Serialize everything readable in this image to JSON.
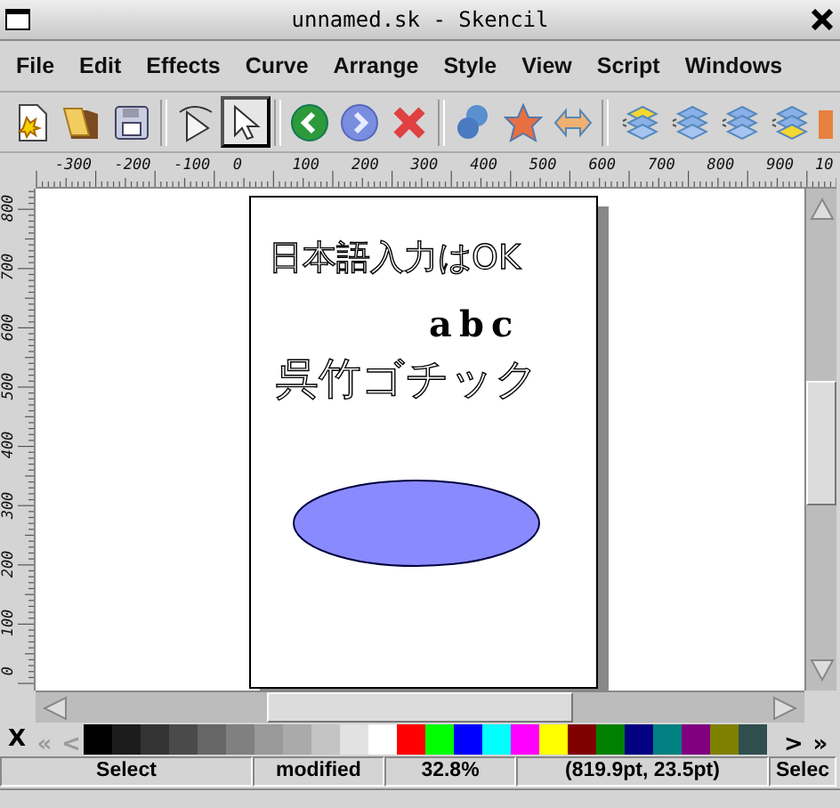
{
  "window": {
    "title": "unnamed.sk - Skencil"
  },
  "menu": [
    "File",
    "Edit",
    "Effects",
    "Curve",
    "Arrange",
    "Style",
    "View",
    "Script",
    "Windows"
  ],
  "toolbar": [
    {
      "kind": "new",
      "selected": false
    },
    {
      "kind": "open",
      "selected": false
    },
    {
      "kind": "save",
      "selected": false
    },
    {
      "kind": "sep"
    },
    {
      "kind": "edit",
      "selected": false
    },
    {
      "kind": "select",
      "selected": true
    },
    {
      "kind": "sep"
    },
    {
      "kind": "undo",
      "selected": false
    },
    {
      "kind": "redo",
      "selected": false
    },
    {
      "kind": "delete",
      "selected": false
    },
    {
      "kind": "sep"
    },
    {
      "kind": "group",
      "selected": false
    },
    {
      "kind": "star",
      "selected": false
    },
    {
      "kind": "arrows",
      "selected": false
    },
    {
      "kind": "sep"
    },
    {
      "kind": "raise",
      "selected": false
    },
    {
      "kind": "lower",
      "selected": false
    },
    {
      "kind": "layer",
      "selected": false
    },
    {
      "kind": "back",
      "selected": false
    },
    {
      "kind": "cut"
    }
  ],
  "ruler": {
    "x_labels": [
      "-300",
      "-200",
      "-100",
      "0",
      "100",
      "200",
      "300",
      "400",
      "500",
      "600",
      "700",
      "800",
      "900",
      "10"
    ],
    "y_labels": [
      "800",
      "700",
      "600",
      "500",
      "400",
      "300",
      "200",
      "100",
      "0"
    ]
  },
  "document": {
    "texts": [
      {
        "kind": "outline",
        "text": "日本語入力はOK"
      },
      {
        "kind": "bold",
        "text": "abc"
      },
      {
        "kind": "outline",
        "text": "呉竹ゴチック"
      }
    ],
    "ellipse": {
      "color": "#8a8aff"
    }
  },
  "palette": {
    "close": "X",
    "first": {
      "label": "«",
      "disabled": true
    },
    "prev": {
      "label": "<",
      "disabled": true
    },
    "next": {
      "label": ">",
      "disabled": false
    },
    "last": {
      "label": "»",
      "disabled": false
    },
    "colors": [
      {
        "color": "#000000"
      },
      {
        "color": "#1c1c1c"
      },
      {
        "color": "#333333"
      },
      {
        "color": "#4a4a4a"
      },
      {
        "color": "#666666"
      },
      {
        "color": "#808080"
      },
      {
        "color": "#999999"
      },
      {
        "color": "#aaaaaa"
      },
      {
        "color": "#c4c4c4"
      },
      {
        "color": "#e2e2e2"
      },
      {
        "color": "#ffffff"
      },
      {
        "color": "#ff0000"
      },
      {
        "color": "#00ff00"
      },
      {
        "color": "#0000ff"
      },
      {
        "color": "#00ffff"
      },
      {
        "color": "#ff00ff"
      },
      {
        "color": "#ffff00"
      },
      {
        "color": "#800000"
      },
      {
        "color": "#008000"
      },
      {
        "color": "#000080"
      },
      {
        "color": "#008080"
      },
      {
        "color": "#800080"
      },
      {
        "color": "#808000"
      },
      {
        "color": "#2f4f4f"
      }
    ]
  },
  "status_bar": [
    "Select",
    "modified",
    "32.8%",
    "(819.9pt, 23.5pt)",
    "Selec"
  ]
}
